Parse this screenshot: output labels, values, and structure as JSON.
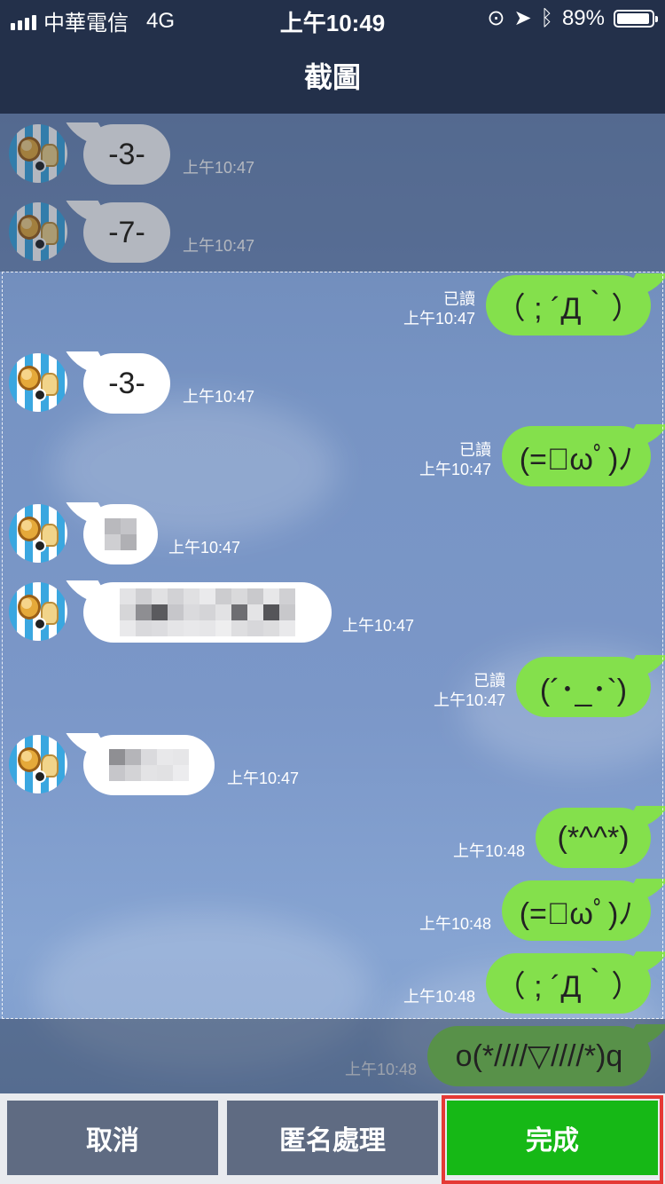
{
  "status": {
    "carrier": "中華電信",
    "network": "4G",
    "time": "上午10:49",
    "battery": "89%"
  },
  "nav": {
    "title": "截圖"
  },
  "messages": [
    {
      "text": "-3-",
      "time": "上午10:47"
    },
    {
      "text": "-7-",
      "time": "上午10:47"
    },
    {
      "text": "（ ; ´Д｀）",
      "time": "上午10:47",
      "read": "已讀"
    },
    {
      "text": "-3-",
      "time": "上午10:47"
    },
    {
      "text": "(=ﾟωﾟ)ﾉ",
      "time": "上午10:47",
      "read": "已讀"
    },
    {
      "time": "上午10:47"
    },
    {
      "time": "上午10:47"
    },
    {
      "text": "(´･_･`)",
      "time": "上午10:47",
      "read": "已讀"
    },
    {
      "time": "上午10:47"
    },
    {
      "text": "(*^^*)",
      "time": "上午10:48"
    },
    {
      "text": "(=ﾟωﾟ)ﾉ",
      "time": "上午10:48"
    },
    {
      "text": "（ ; ´Д｀）",
      "time": "上午10:48"
    },
    {
      "text": "o(*////▽////*)q",
      "time": "上午10:48"
    }
  ],
  "toolbar": {
    "cancel": "取消",
    "anonymize": "匿名處理",
    "done": "完成"
  },
  "colors": {
    "header": "#23304a",
    "outgoing_bubble": "#84e04c",
    "incoming_bubble": "#ffffff",
    "done_button": "#16b816",
    "gray_button": "#5f6b82",
    "highlight": "#e53935"
  }
}
